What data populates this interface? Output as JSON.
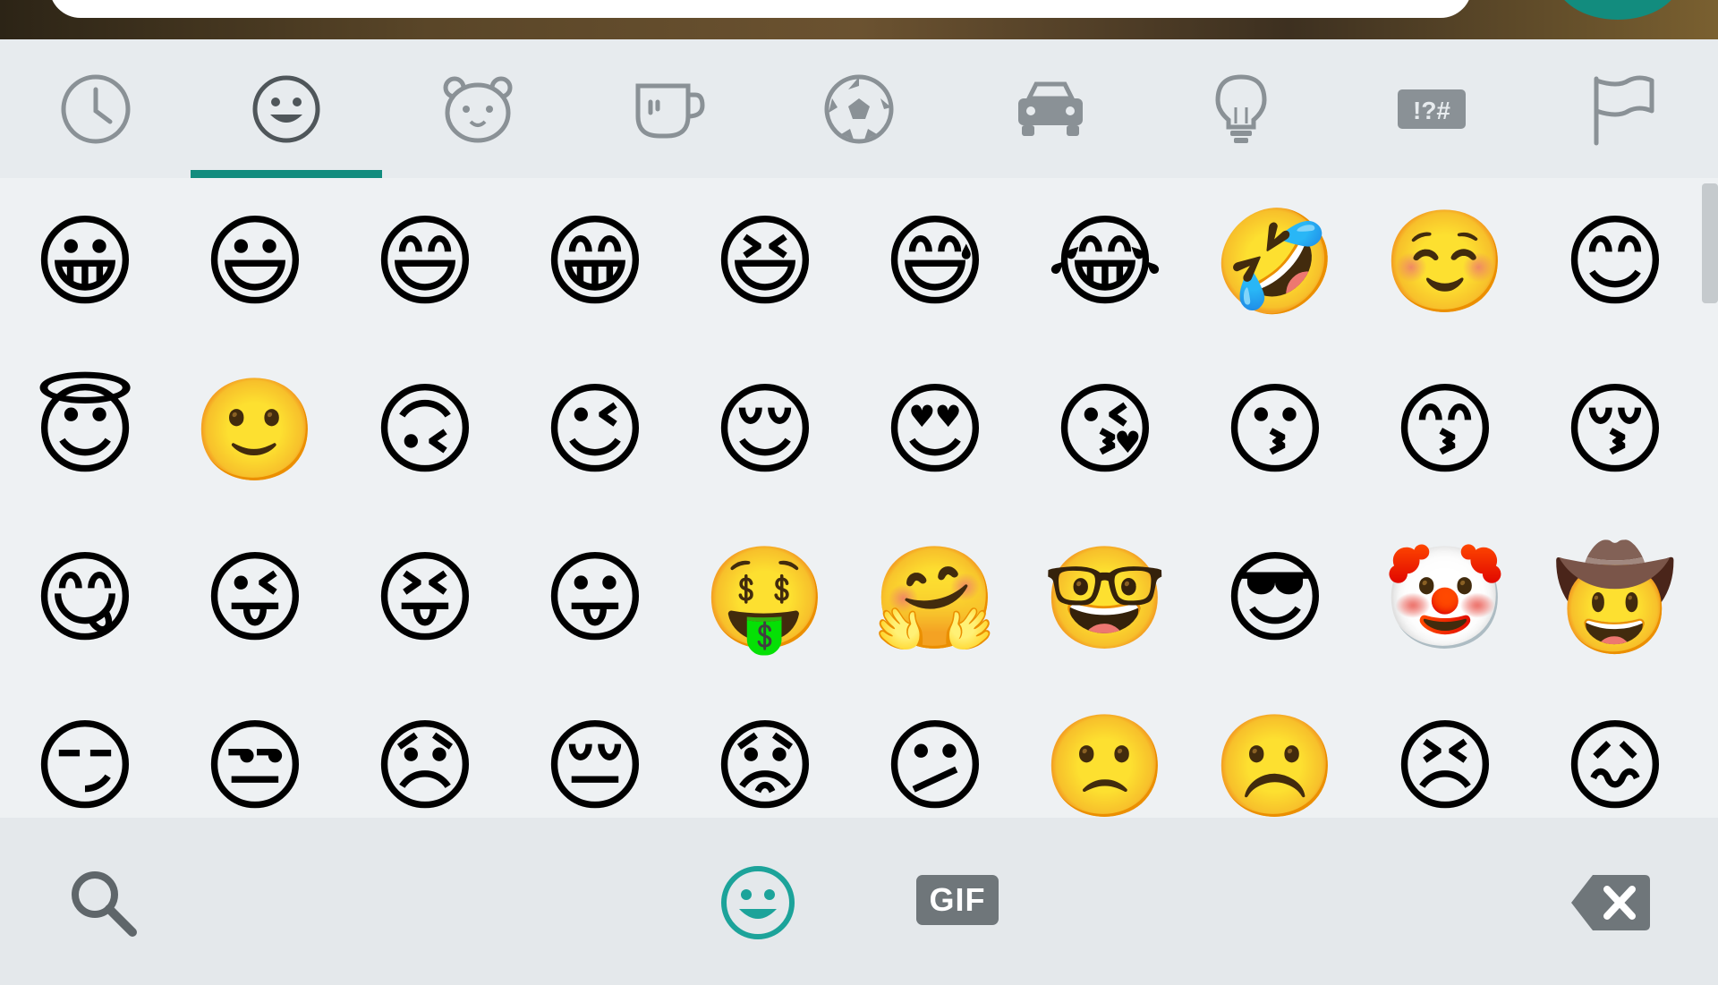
{
  "colors": {
    "accent": "#128c7e",
    "icon_gray": "#7d8489",
    "tab_bg": "#e7ebee",
    "grid_bg": "#eef1f3",
    "bottom_bg": "#e4e8eb"
  },
  "top": {
    "message_input": "",
    "send_icon": "send-icon"
  },
  "categories": [
    {
      "name": "recent",
      "icon": "clock-icon",
      "selected": false
    },
    {
      "name": "smileys",
      "icon": "smiley-icon",
      "selected": true
    },
    {
      "name": "animals",
      "icon": "bear-icon",
      "selected": false
    },
    {
      "name": "food",
      "icon": "cup-icon",
      "selected": false
    },
    {
      "name": "activities",
      "icon": "soccer-ball-icon",
      "selected": false
    },
    {
      "name": "travel",
      "icon": "car-icon",
      "selected": false
    },
    {
      "name": "objects",
      "icon": "lightbulb-icon",
      "selected": false
    },
    {
      "name": "symbols",
      "icon": "symbols-icon",
      "label": "!?#",
      "selected": false
    },
    {
      "name": "flags",
      "icon": "flag-icon",
      "selected": false
    }
  ],
  "emojis": [
    "😀",
    "😃",
    "😄",
    "😁",
    "😆",
    "😅",
    "😂",
    "🤣",
    "☺️",
    "😊",
    "😇",
    "🙂",
    "🙃",
    "😉",
    "😌",
    "😍",
    "😘",
    "😗",
    "😙",
    "😚",
    "😋",
    "😜",
    "😝",
    "😛",
    "🤑",
    "🤗",
    "🤓",
    "😎",
    "🤡",
    "🤠",
    "😏",
    "😒",
    "😞",
    "😔",
    "😟",
    "😕",
    "🙁",
    "☹️",
    "😣",
    "😖"
  ],
  "bottom": {
    "search_icon": "search-icon",
    "emoji_icon": "smiley-icon",
    "gif_label": "GIF",
    "backspace_icon": "backspace-icon"
  }
}
